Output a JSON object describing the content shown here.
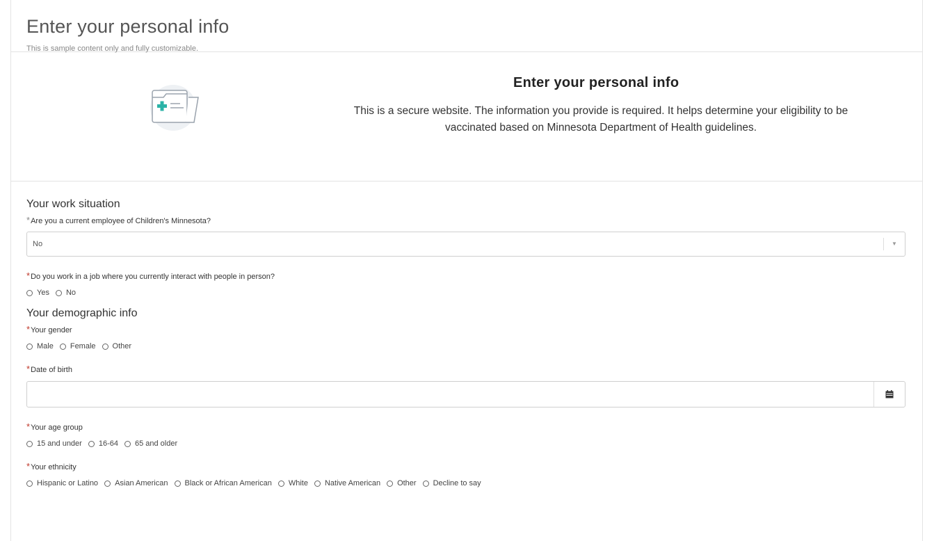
{
  "header": {
    "title": "Enter your personal info",
    "subtitle": "This is sample content only and fully customizable."
  },
  "banner": {
    "icon": "medical-folder-icon",
    "title": "Enter your personal info",
    "text": "This is a secure website. The information you provide is required. It helps determine your eligibility to be vaccinated based on Minnesota Department of Health guidelines."
  },
  "work": {
    "section_title": "Your work situation",
    "employee_question": "Are you a current employee of Children's Minnesota?",
    "employee_value": "No",
    "interact_question": "Do you work in a job where you currently interact with people in person?",
    "interact_options": [
      "Yes",
      "No"
    ]
  },
  "demographic": {
    "section_title": "Your demographic info",
    "gender_label": "Your gender",
    "gender_options": [
      "Male",
      "Female",
      "Other"
    ],
    "dob_label": "Date of birth",
    "dob_value": "",
    "age_label": "Your age group",
    "age_options": [
      "15 and under",
      "16-64",
      "65 and older"
    ],
    "ethnicity_label": "Your ethnicity",
    "ethnicity_options": [
      "Hispanic or Latino",
      "Asian American",
      "Black or African American",
      "White",
      "Native American",
      "Other",
      "Decline to say"
    ]
  },
  "colors": {
    "required": "#c0392b",
    "border": "#cfcfcf",
    "icon_teal": "#2bb3a7",
    "icon_bg": "#eef1f4"
  }
}
